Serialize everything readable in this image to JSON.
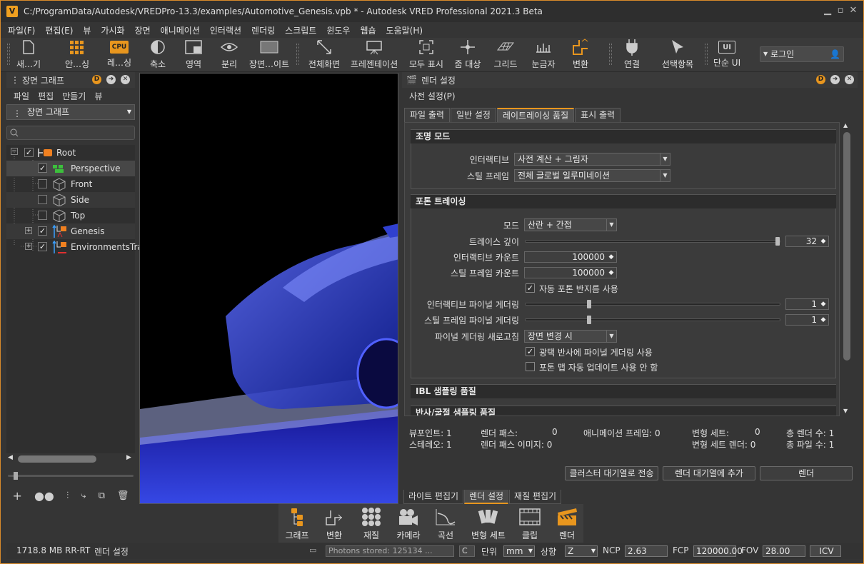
{
  "window": {
    "title": "C:/ProgramData/Autodesk/VREDPro-13.3/examples/Automotive_Genesis.vpb * - Autodesk VRED Professional 2021.3 Beta",
    "logo": "V"
  },
  "menubar": [
    "파일(F)",
    "편집(E)",
    "뷰",
    "가시화",
    "장면",
    "애니메이션",
    "인터랙션",
    "렌더링",
    "스크립트",
    "윈도우",
    "웹숍",
    "도움말(H)"
  ],
  "toolbar": {
    "items": [
      {
        "label": "새…기",
        "icon": "document-icon"
      },
      {
        "label": "안…싱",
        "icon": "antialiasing-icon"
      },
      {
        "label": "레…싱",
        "icon": "cpu-raytracing-icon"
      },
      {
        "label": "축소",
        "icon": "contrast-icon"
      },
      {
        "label": "영역",
        "icon": "region-icon"
      },
      {
        "label": "분리",
        "icon": "eye-icon"
      },
      {
        "label": "장면…이트",
        "icon": "scene-plate-icon"
      },
      {
        "label": "전체화면",
        "icon": "fullscreen-icon"
      },
      {
        "label": "프레젠테이션",
        "icon": "presentation-icon"
      },
      {
        "label": "모두 표시",
        "icon": "show-all-icon"
      },
      {
        "label": "줌 대상",
        "icon": "zoom-to-icon"
      },
      {
        "label": "그리드",
        "icon": "grid-icon"
      },
      {
        "label": "눈금자",
        "icon": "ruler-icon"
      },
      {
        "label": "변환",
        "icon": "transform-icon"
      },
      {
        "label": "연결",
        "icon": "plug-icon"
      },
      {
        "label": "선택항목",
        "icon": "select-icon"
      },
      {
        "label": "단순 UI",
        "icon": "simple-ui-icon"
      }
    ],
    "cpu_text": "CPU",
    "ui_text": "UI",
    "login_label": "로그인"
  },
  "scenegraph": {
    "panel_title": "장면 그래프",
    "menu": [
      "파일",
      "편집",
      "만들기",
      "뷰"
    ],
    "combo_value": "장면 그래프",
    "search_placeholder": "",
    "nodes": [
      {
        "label": "Root",
        "checked": "✓"
      },
      {
        "label": "Perspective",
        "checked": "✓"
      },
      {
        "label": "Front",
        "checked": ""
      },
      {
        "label": "Side",
        "checked": ""
      },
      {
        "label": "Top",
        "checked": ""
      },
      {
        "label": "Genesis",
        "checked": "✓"
      },
      {
        "label": "EnvironmentsTra",
        "checked": "✓"
      }
    ]
  },
  "render_settings": {
    "panel_title": "렌더 설정",
    "presets_menu": "사전 설정(P)",
    "tabs": [
      "파일 출력",
      "일반 설정",
      "레이트레이싱 품질",
      "표시 출력"
    ],
    "lighting": {
      "header": "조명 모드",
      "interactive_label": "인터랙티브",
      "interactive_value": "사전 계산 + 그림자",
      "still_label": "스틸 프레임",
      "still_value": "전체 글로벌 일루미네이션"
    },
    "photon": {
      "header": "포톤 트레이싱",
      "mode_label": "모드",
      "mode_value": "산란 + 간접",
      "trace_depth_label": "트레이스 깊이",
      "trace_depth_value": "32",
      "interactive_count_label": "인터랙티브 카운트",
      "interactive_count_value": "100000",
      "still_count_label": "스틸 프레임 카운트",
      "still_count_value": "100000",
      "auto_radius_label": "자동 포톤 반지름 사용",
      "final_gather_interactive_label": "인터랙티브 파이널 게더링",
      "final_gather_interactive_value": "1",
      "final_gather_still_label": "스틸 프레임 파이널 게더링",
      "final_gather_still_value": "1",
      "refresh_label": "파이널 게더링 새로고침",
      "refresh_value": "장면 변경 시",
      "glossy_label": "광택 반사에 파이널 게더링 사용",
      "no_auto_update_label": "포톤 맵 자동 업데이트 사용 안 함"
    },
    "ibl_header": "IBL 샘플링 품질",
    "reflection_header": "반사/굴절 샘플링 품질",
    "stats": {
      "viewport": "뷰포인트: 1",
      "stereo": "스테레오: 1",
      "render_passes": "렌더 패스:",
      "render_passes_value": "0",
      "render_pass_images": "렌더 패스 이미지: 0",
      "anim_frames": "애니메이션 프레임: 0",
      "variant_sets": "변형 세트:",
      "variant_sets_value": "0",
      "variant_set_renders": "변형 세트 렌더: 0",
      "total_renders": "총 렌더 수: 1",
      "total_files": "총 파일 수: 1"
    },
    "buttons": {
      "cluster": "클러스터 대기열로 전송",
      "queue": "렌더 대기열에 추가",
      "render": "렌더"
    },
    "bottom_tabs": [
      "라이트 편집기",
      "렌더 설정",
      "재질 편집기"
    ]
  },
  "dock": [
    {
      "label": "그래프",
      "icon": "graph-icon"
    },
    {
      "label": "변환",
      "icon": "transform-icon"
    },
    {
      "label": "재질",
      "icon": "material-icon"
    },
    {
      "label": "카메라",
      "icon": "camera-icon"
    },
    {
      "label": "곡선",
      "icon": "curve-icon"
    },
    {
      "label": "변형 세트",
      "icon": "variant-set-icon"
    },
    {
      "label": "클립",
      "icon": "clip-icon"
    },
    {
      "label": "렌더",
      "icon": "clapper-icon"
    }
  ],
  "statusbar": {
    "memory": "1718.8 MB",
    "mode": "RR-RT",
    "context": "렌더 설정",
    "console_text": "Photons stored: 125134 ...",
    "unit_label": "단위",
    "unit_value": "mm",
    "up_label": "상향",
    "up_value": "Z",
    "ncp_label": "NCP",
    "ncp_value": "2.63",
    "fcp_label": "FCP",
    "fcp_value": "120000.00",
    "fov_label": "FOV",
    "fov_value": "28.00",
    "icv_label": "ICV"
  },
  "colors": {
    "accent": "#e8961e",
    "render_blue": "#2a3cff",
    "tree_orange": "#f08020"
  }
}
